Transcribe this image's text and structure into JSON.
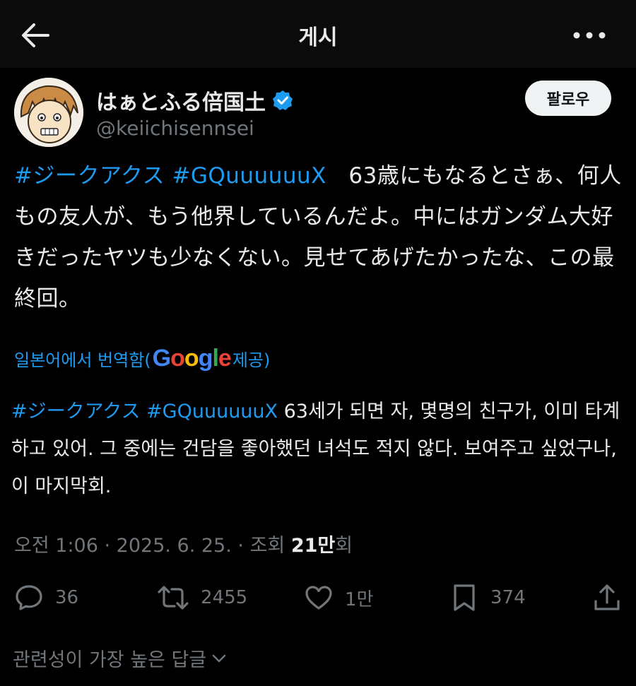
{
  "header": {
    "title": "게시"
  },
  "author": {
    "display_name": "はぁとふる倍国土",
    "handle": "@keiichisennsei",
    "verified": true
  },
  "follow_button": {
    "label": "팔로우"
  },
  "tweet": {
    "segments": [
      {
        "text": "#ジークアクス",
        "type": "hashtag"
      },
      {
        "text": " ",
        "type": "text"
      },
      {
        "text": "#GQuuuuuuX",
        "type": "hashtag"
      },
      {
        "text": "　63歳にもなるとさぁ、何人もの友人が、もう他界しているんだよ。中にはガンダム大好きだったヤツも少なくない。見せてあげたかったな、この最終回。",
        "type": "text"
      }
    ]
  },
  "translation": {
    "prefix": "일본어에서 번역함(",
    "provider": "Google",
    "suffix": " 제공)",
    "segments": [
      {
        "text": "#ジークアクス",
        "type": "hashtag"
      },
      {
        "text": " ",
        "type": "text"
      },
      {
        "text": "#GQuuuuuuX",
        "type": "hashtag"
      },
      {
        "text": " 63세가 되면 자, 몇명의 친구가, 이미 타계하고 있어. 그 중에는 건담을 좋아했던 녀석도 적지 않다. 보여주고 싶었구나, 이 마지막회.",
        "type": "text"
      }
    ]
  },
  "meta": {
    "time": "오전 1:06",
    "date": "2025. 6. 25.",
    "views_label": "조회",
    "views_count": "21만",
    "views_suffix": "회"
  },
  "actions": {
    "replies": "36",
    "reposts": "2455",
    "likes": "1만",
    "bookmarks": "374"
  },
  "replies_sort": {
    "label": "관련성이 가장 높은 답글"
  },
  "colors": {
    "background": "#000000",
    "accent": "#1d9bf0",
    "text": "#e7e9ea",
    "muted": "#71767b"
  }
}
